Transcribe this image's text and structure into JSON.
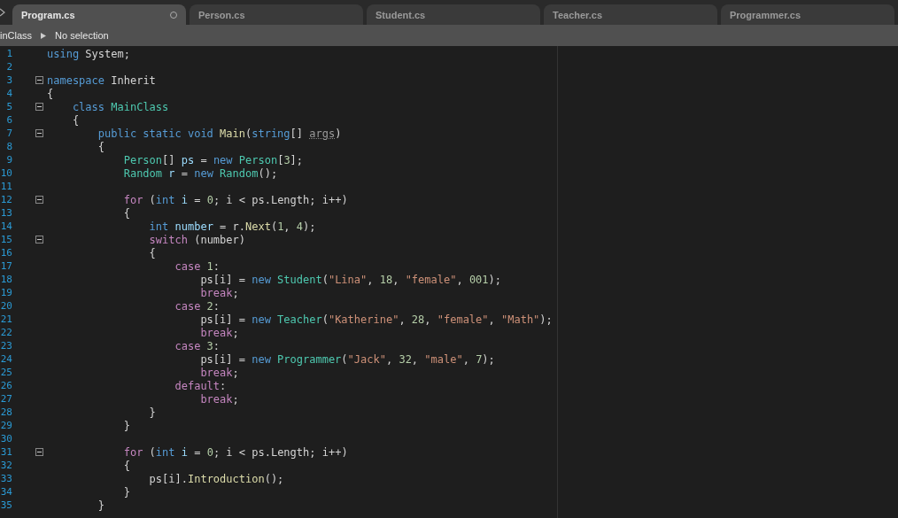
{
  "tabs": [
    {
      "label": "Program.cs",
      "selected": true,
      "modified": true
    },
    {
      "label": "Person.cs",
      "selected": false,
      "modified": false
    },
    {
      "label": "Student.cs",
      "selected": false,
      "modified": false
    },
    {
      "label": "Teacher.cs",
      "selected": false,
      "modified": false
    },
    {
      "label": "Programmer.cs",
      "selected": false,
      "modified": false
    }
  ],
  "breadcrumb": [
    "inClass",
    "No selection"
  ],
  "lines": [
    {
      "number": "1",
      "fold": false,
      "tokens": [
        {
          "kind": "keyword",
          "text": "using"
        },
        {
          "kind": "plain",
          "text": " System;"
        }
      ]
    },
    {
      "number": "2",
      "fold": false
    },
    {
      "number": "3",
      "fold": true,
      "tokens": [
        {
          "kind": "keyword",
          "text": "namespace"
        },
        {
          "kind": "plain",
          "text": " Inherit"
        }
      ]
    },
    {
      "number": "4",
      "fold": false,
      "tokens": [
        {
          "kind": "plain",
          "text": "{"
        }
      ]
    },
    {
      "number": "5",
      "fold": true,
      "tokens": [
        {
          "kind": "keyword",
          "text": "    class"
        },
        {
          "kind": "type",
          "text": " MainClass"
        }
      ]
    },
    {
      "number": "6",
      "fold": false,
      "tokens": [
        {
          "kind": "plain",
          "text": "    {"
        }
      ]
    },
    {
      "number": "7",
      "fold": true,
      "tokens": [
        {
          "kind": "keyword",
          "text": "        public static void"
        },
        {
          "kind": "method",
          "text": " Main"
        },
        {
          "kind": "plain",
          "text": "("
        },
        {
          "kind": "keyword",
          "text": "string"
        },
        {
          "kind": "plain",
          "text": "[] "
        },
        {
          "kind": "unused",
          "text": "args"
        },
        {
          "kind": "plain",
          "text": ")"
        }
      ]
    },
    {
      "number": "8",
      "fold": false,
      "tokens": [
        {
          "kind": "plain",
          "text": "        {"
        }
      ]
    },
    {
      "number": "9",
      "fold": false,
      "tokens": [
        {
          "kind": "type",
          "text": "            Person"
        },
        {
          "kind": "plain",
          "text": "[] "
        },
        {
          "kind": "variable",
          "text": "ps"
        },
        {
          "kind": "plain",
          "text": " = "
        },
        {
          "kind": "keyword",
          "text": "new"
        },
        {
          "kind": "type",
          "text": " Person"
        },
        {
          "kind": "plain",
          "text": "["
        },
        {
          "kind": "number",
          "text": "3"
        },
        {
          "kind": "plain",
          "text": "];"
        }
      ]
    },
    {
      "number": "10",
      "fold": false,
      "tokens": [
        {
          "kind": "type",
          "text": "            Random"
        },
        {
          "kind": "variable",
          "text": " r"
        },
        {
          "kind": "plain",
          "text": " = "
        },
        {
          "kind": "keyword",
          "text": "new"
        },
        {
          "kind": "type",
          "text": " Random"
        },
        {
          "kind": "plain",
          "text": "();"
        }
      ]
    },
    {
      "number": "11",
      "fold": false
    },
    {
      "number": "12",
      "fold": true,
      "tokens": [
        {
          "kind": "control",
          "text": "            for"
        },
        {
          "kind": "plain",
          "text": " ("
        },
        {
          "kind": "keyword",
          "text": "int"
        },
        {
          "kind": "variable",
          "text": " i"
        },
        {
          "kind": "plain",
          "text": " = "
        },
        {
          "kind": "number",
          "text": "0"
        },
        {
          "kind": "plain",
          "text": "; i < ps.Length; i++)"
        }
      ]
    },
    {
      "number": "13",
      "fold": false,
      "tokens": [
        {
          "kind": "plain",
          "text": "            {"
        }
      ]
    },
    {
      "number": "14",
      "fold": false,
      "tokens": [
        {
          "kind": "keyword",
          "text": "                int"
        },
        {
          "kind": "variable",
          "text": " number"
        },
        {
          "kind": "plain",
          "text": " = r."
        },
        {
          "kind": "method",
          "text": "Next"
        },
        {
          "kind": "plain",
          "text": "("
        },
        {
          "kind": "number",
          "text": "1"
        },
        {
          "kind": "plain",
          "text": ", "
        },
        {
          "kind": "number",
          "text": "4"
        },
        {
          "kind": "plain",
          "text": ");"
        }
      ]
    },
    {
      "number": "15",
      "fold": true,
      "tokens": [
        {
          "kind": "control",
          "text": "                switch"
        },
        {
          "kind": "plain",
          "text": " (number)"
        }
      ]
    },
    {
      "number": "16",
      "fold": false,
      "tokens": [
        {
          "kind": "plain",
          "text": "                {"
        }
      ]
    },
    {
      "number": "17",
      "fold": false,
      "tokens": [
        {
          "kind": "control",
          "text": "                    case"
        },
        {
          "kind": "number",
          "text": " 1"
        },
        {
          "kind": "plain",
          "text": ":"
        }
      ]
    },
    {
      "number": "18",
      "fold": false,
      "tokens": [
        {
          "kind": "plain",
          "text": "                        ps[i] = "
        },
        {
          "kind": "keyword",
          "text": "new"
        },
        {
          "kind": "type",
          "text": " Student"
        },
        {
          "kind": "plain",
          "text": "("
        },
        {
          "kind": "string",
          "text": "\"Lina\""
        },
        {
          "kind": "plain",
          "text": ", "
        },
        {
          "kind": "number",
          "text": "18"
        },
        {
          "kind": "plain",
          "text": ", "
        },
        {
          "kind": "string",
          "text": "\"female\""
        },
        {
          "kind": "plain",
          "text": ", "
        },
        {
          "kind": "number",
          "text": "001"
        },
        {
          "kind": "plain",
          "text": ");"
        }
      ]
    },
    {
      "number": "19",
      "fold": false,
      "tokens": [
        {
          "kind": "control",
          "text": "                        break"
        },
        {
          "kind": "plain",
          "text": ";"
        }
      ]
    },
    {
      "number": "20",
      "fold": false,
      "tokens": [
        {
          "kind": "control",
          "text": "                    case"
        },
        {
          "kind": "number",
          "text": " 2"
        },
        {
          "kind": "plain",
          "text": ":"
        }
      ]
    },
    {
      "number": "21",
      "fold": false,
      "tokens": [
        {
          "kind": "plain",
          "text": "                        ps[i] = "
        },
        {
          "kind": "keyword",
          "text": "new"
        },
        {
          "kind": "type",
          "text": " Teacher"
        },
        {
          "kind": "plain",
          "text": "("
        },
        {
          "kind": "string",
          "text": "\"Katherine\""
        },
        {
          "kind": "plain",
          "text": ", "
        },
        {
          "kind": "number",
          "text": "28"
        },
        {
          "kind": "plain",
          "text": ", "
        },
        {
          "kind": "string",
          "text": "\"female\""
        },
        {
          "kind": "plain",
          "text": ", "
        },
        {
          "kind": "string",
          "text": "\"Math\""
        },
        {
          "kind": "plain",
          "text": ");"
        }
      ]
    },
    {
      "number": "22",
      "fold": false,
      "tokens": [
        {
          "kind": "control",
          "text": "                        break"
        },
        {
          "kind": "plain",
          "text": ";"
        }
      ]
    },
    {
      "number": "23",
      "fold": false,
      "tokens": [
        {
          "kind": "control",
          "text": "                    case"
        },
        {
          "kind": "number",
          "text": " 3"
        },
        {
          "kind": "plain",
          "text": ":"
        }
      ]
    },
    {
      "number": "24",
      "fold": false,
      "tokens": [
        {
          "kind": "plain",
          "text": "                        ps[i] = "
        },
        {
          "kind": "keyword",
          "text": "new"
        },
        {
          "kind": "type",
          "text": " Programmer"
        },
        {
          "kind": "plain",
          "text": "("
        },
        {
          "kind": "string",
          "text": "\"Jack\""
        },
        {
          "kind": "plain",
          "text": ", "
        },
        {
          "kind": "number",
          "text": "32"
        },
        {
          "kind": "plain",
          "text": ", "
        },
        {
          "kind": "string",
          "text": "\"male\""
        },
        {
          "kind": "plain",
          "text": ", "
        },
        {
          "kind": "number",
          "text": "7"
        },
        {
          "kind": "plain",
          "text": ");"
        }
      ]
    },
    {
      "number": "25",
      "fold": false,
      "tokens": [
        {
          "kind": "control",
          "text": "                        break"
        },
        {
          "kind": "plain",
          "text": ";"
        }
      ]
    },
    {
      "number": "26",
      "fold": false,
      "tokens": [
        {
          "kind": "control",
          "text": "                    default"
        },
        {
          "kind": "plain",
          "text": ":"
        }
      ]
    },
    {
      "number": "27",
      "fold": false,
      "tokens": [
        {
          "kind": "control",
          "text": "                        break"
        },
        {
          "kind": "plain",
          "text": ";"
        }
      ]
    },
    {
      "number": "28",
      "fold": false,
      "tokens": [
        {
          "kind": "plain",
          "text": "                }"
        }
      ]
    },
    {
      "number": "29",
      "fold": false,
      "tokens": [
        {
          "kind": "plain",
          "text": "            }"
        }
      ]
    },
    {
      "number": "30",
      "fold": false
    },
    {
      "number": "31",
      "fold": true,
      "tokens": [
        {
          "kind": "control",
          "text": "            for"
        },
        {
          "kind": "plain",
          "text": " ("
        },
        {
          "kind": "keyword",
          "text": "int"
        },
        {
          "kind": "variable",
          "text": " i"
        },
        {
          "kind": "plain",
          "text": " = "
        },
        {
          "kind": "number",
          "text": "0"
        },
        {
          "kind": "plain",
          "text": "; i < ps.Length; i++)"
        }
      ]
    },
    {
      "number": "32",
      "fold": false,
      "tokens": [
        {
          "kind": "plain",
          "text": "            {"
        }
      ]
    },
    {
      "number": "33",
      "fold": false,
      "tokens": [
        {
          "kind": "plain",
          "text": "                ps[i]."
        },
        {
          "kind": "method",
          "text": "Introduction"
        },
        {
          "kind": "plain",
          "text": "();"
        }
      ]
    },
    {
      "number": "34",
      "fold": false,
      "tokens": [
        {
          "kind": "plain",
          "text": "            }"
        }
      ]
    },
    {
      "number": "35",
      "fold": false,
      "tokens": [
        {
          "kind": "plain",
          "text": "        }"
        }
      ]
    }
  ]
}
